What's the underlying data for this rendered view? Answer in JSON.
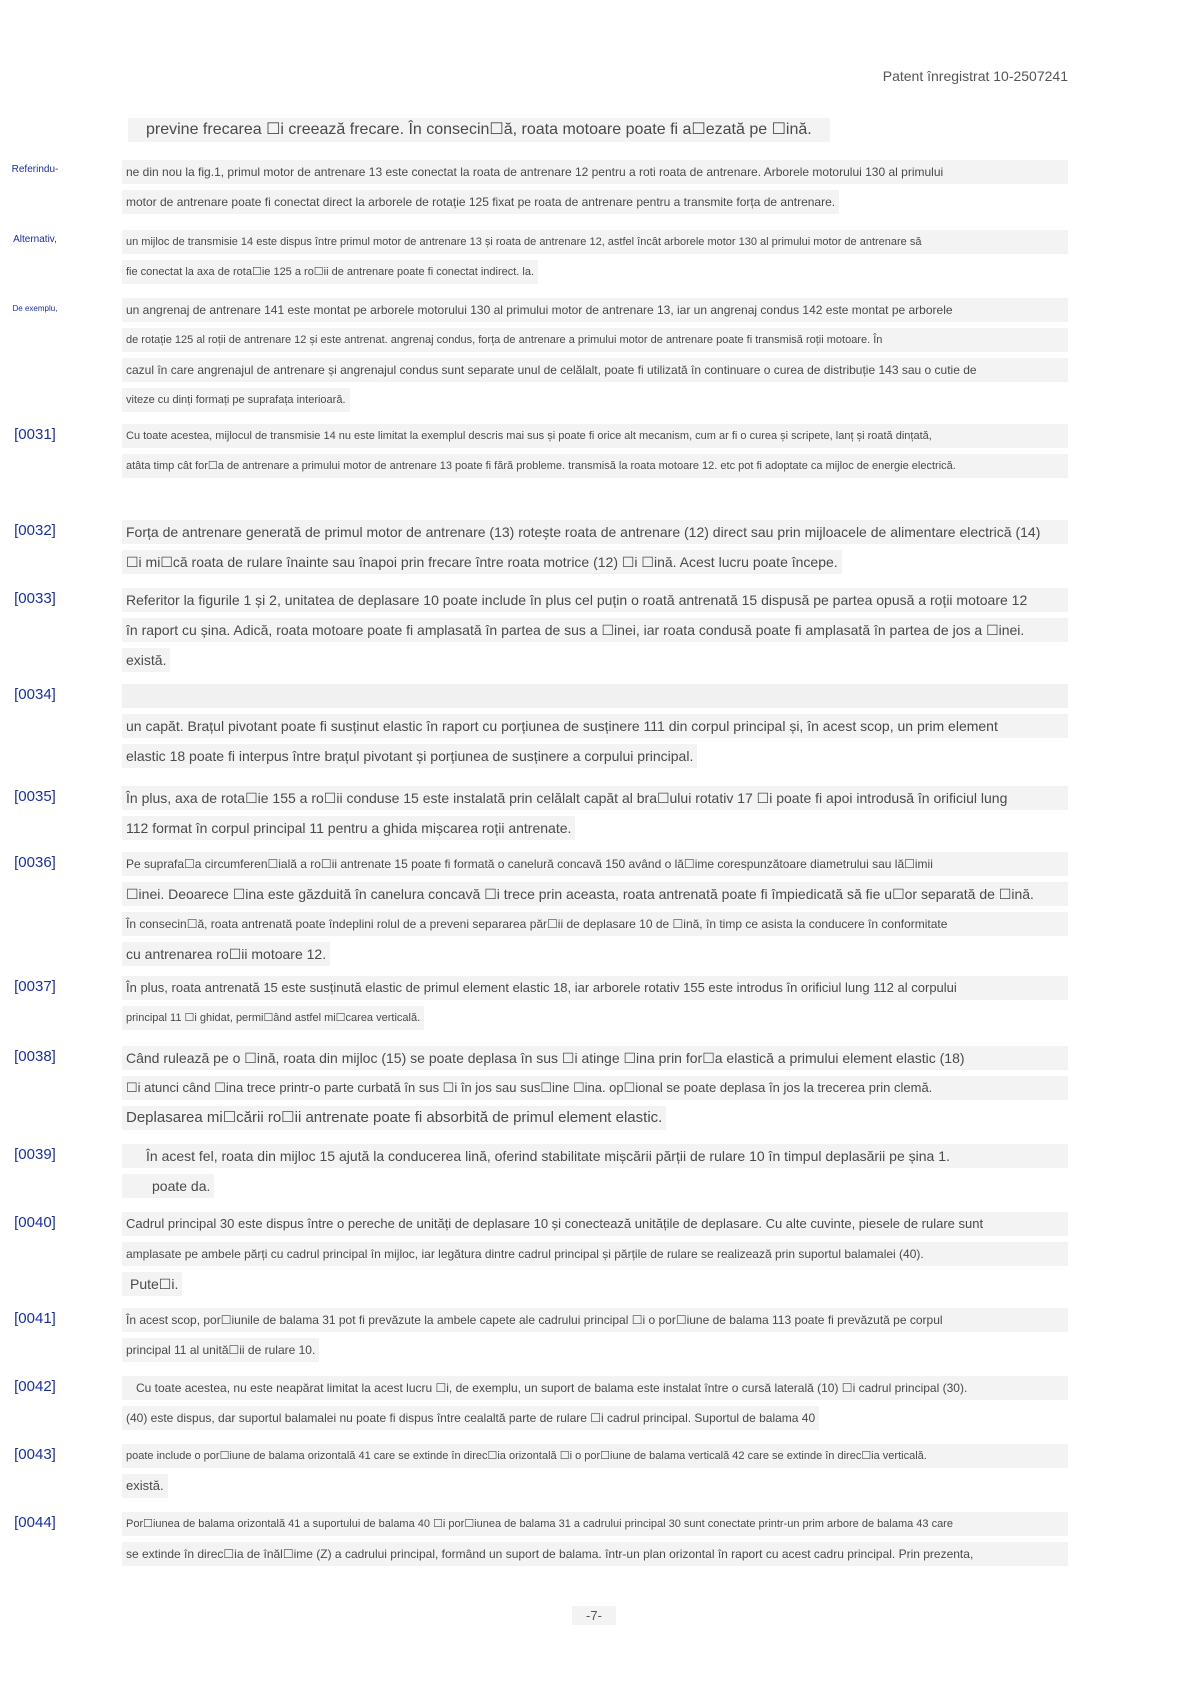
{
  "header": {
    "patent_ref": "Patent înregistrat 10-2507241"
  },
  "intro": {
    "line": "previne frecarea ☐i creează frecare. În consecin☐ă, roata motoare poate fi a☐ezată pe ☐ină."
  },
  "blocks": [
    {
      "label": "Referindu-",
      "lines": [
        "ne din nou la fig.1, primul motor de antrenare 13 este conectat la roata de antrenare 12 pentru a roti roata de antrenare. Arborele motorului 130 al primului",
        "motor de antrenare poate fi conectat direct la arborele de rotație 125 fixat pe roata de antrenare pentru a transmite forța de antrenare."
      ]
    },
    {
      "label": "Alternativ,",
      "lines": [
        "un mijloc de transmisie 14 este dispus între primul motor de antrenare 13 și roata de antrenare 12, astfel încât arborele motor 130 al primului motor de antrenare să",
        "fie conectat la axa de rota☐ie 125 a ro☐ii de antrenare poate fi conectat indirect. la."
      ]
    },
    {
      "label": "De exemplu,",
      "lines": [
        "un angrenaj de antrenare 141 este montat pe arborele motorului 130 al primului motor de antrenare 13, iar un angrenaj condus 142 este montat pe arborele",
        "de rotație 125 al roții de antrenare 12 și este antrenat. angrenaj condus, forța de antrenare a primului motor de antrenare poate fi transmisă roții motoare. În",
        "cazul în care angrenajul de antrenare și angrenajul condus sunt separate unul de celălalt, poate fi utilizată în continuare o curea de distribuție 143 sau o cutie de",
        "viteze cu dinți formați pe suprafața interioară."
      ]
    },
    {
      "label": "[0031]",
      "lines": [
        "Cu toate acestea, mijlocul de transmisie 14 nu este limitat la exemplul descris mai sus și poate fi orice alt mecanism, cum ar fi o curea și scripete, lanț și roată dințată,",
        "atâta timp cât for☐a de antrenare a primului motor de antrenare 13 poate fi fără probleme. transmisă la roata motoare 12. etc pot fi adoptate ca mijloc de energie electrică."
      ]
    },
    {
      "label": "[0032]",
      "lines": [
        "Forța de antrenare generată de primul motor de antrenare (13) rotește roata de antrenare (12) direct sau prin mijloacele de alimentare electrică (14)",
        "☐i mi☐că roata de rulare înainte sau înapoi prin frecare între roata motrice (12) ☐i ☐ină. Acest lucru poate începe."
      ]
    },
    {
      "label": "[0033]",
      "lines": [
        "Referitor la figurile 1 și 2, unitatea de deplasare 10 poate include în plus cel puțin o roată antrenată 15 dispusă pe partea opusă a roții motoare 12",
        "în raport cu șina. Adică, roata motoare poate fi amplasată în partea de sus a ☐inei, iar roata condusă poate fi amplasată în partea de jos a ☐inei.",
        "există."
      ]
    },
    {
      "label": "[0034]",
      "lines": [
        "un capăt. Brațul pivotant poate fi susținut elastic în raport cu porțiunea de susținere 111 din corpul principal și, în acest scop, un prim element",
        "elastic 18 poate fi interpus între brațul pivotant și porțiunea de susținere a corpului principal."
      ]
    },
    {
      "label": "[0035]",
      "lines": [
        "În plus, axa de rota☐ie 155 a ro☐ii conduse 15 este instalată prin celălalt capăt al bra☐ului rotativ 17 ☐i poate fi apoi introdusă în orificiul lung",
        "112 format în corpul principal 11 pentru a ghida mișcarea roții antrenate."
      ]
    },
    {
      "label": "[0036]",
      "lines": [
        "Pe suprafa☐a circumferen☐ială a ro☐ii antrenate 15 poate fi formată o canelură concavă 150 având o lă☐ime corespunzătoare diametrului sau lă☐imii",
        "☐inei. Deoarece ☐ina este găzduită în canelura concavă ☐i trece prin aceasta, roata antrenată poate fi împiedicată să fie u☐or separată de ☐ină.",
        "În consecin☐ă, roata antrenată poate îndeplini rolul de a preveni separarea păr☐ii de deplasare 10 de ☐ină, în timp ce asista la conducere în conformitate",
        "cu antrenarea ro☐ii motoare 12."
      ]
    },
    {
      "label": "[0037]",
      "lines": [
        "În plus, roata antrenată 15 este susținută elastic de primul element elastic 18, iar arborele rotativ 155 este introdus în orificiul lung 112 al corpului",
        "principal 11 ☐i ghidat, permi☐ând astfel mi☐carea verticală."
      ]
    },
    {
      "label": "[0038]",
      "lines": [
        "Când rulează pe o ☐ină, roata din mijloc (15) se poate deplasa în sus ☐i atinge ☐ina prin for☐a elastică a primului element elastic (18)",
        "☐i atunci când ☐ina trece printr-o parte curbată în sus ☐i în jos sau sus☐ine ☐ina. op☐ional se poate deplasa în jos la trecerea prin clemă.",
        "Deplasarea mi☐cării ro☐ii antrenate poate fi absorbită de primul element elastic."
      ]
    },
    {
      "label": "[0039]",
      "lines": [
        "În acest fel, roata din mijloc 15 ajută la conducerea lină, oferind stabilitate mișcării părții de rulare 10 în timpul deplasării pe șina 1.",
        "poate da."
      ]
    },
    {
      "label": "[0040]",
      "lines": [
        "Cadrul principal 30 este dispus între o pereche de unități de deplasare 10 și conectează unitățile de deplasare. Cu alte cuvinte, piesele de rulare sunt",
        "amplasate pe ambele părți cu cadrul principal în mijloc, iar legătura dintre cadrul principal și părțile de rulare se realizează prin suportul balamalei (40).",
        "Pute☐i."
      ]
    },
    {
      "label": "[0041]",
      "lines": [
        "În acest scop, por☐iunile de balama 31 pot fi prevăzute la ambele capete ale cadrului principal ☐i o por☐iune de balama 113 poate fi prevăzută pe corpul",
        "principal 11 al unită☐ii de rulare 10."
      ]
    },
    {
      "label": "[0042]",
      "lines": [
        "Cu toate acestea, nu este neapărat limitat la acest lucru ☐i, de exemplu, un suport de balama este instalat între o cursă laterală (10) ☐i cadrul principal (30).",
        "(40) este dispus, dar suportul balamalei nu poate fi dispus între cealaltă parte de rulare ☐i cadrul principal. Suportul de balama 40"
      ]
    },
    {
      "label": "[0043]",
      "lines": [
        "poate include o por☐iune de balama orizontală 41 care se extinde în direc☐ia orizontală ☐i o por☐iune de balama verticală 42 care se extinde în direc☐ia verticală.",
        "există."
      ]
    },
    {
      "label": "[0044]",
      "lines": [
        "Por☐iunea de balama orizontală 41 a suportului de balama 40 ☐i por☐iunea de balama 31 a cadrului principal 30 sunt conectate printr-un prim arbore de balama 43 care",
        "se extinde în direc☐ia de înăl☐ime (Z) a cadrului principal, formând un suport de balama. într-un plan orizontal în raport cu acest cadru principal. Prin prezenta,"
      ]
    }
  ],
  "footer": {
    "page_number": "-7-"
  }
}
